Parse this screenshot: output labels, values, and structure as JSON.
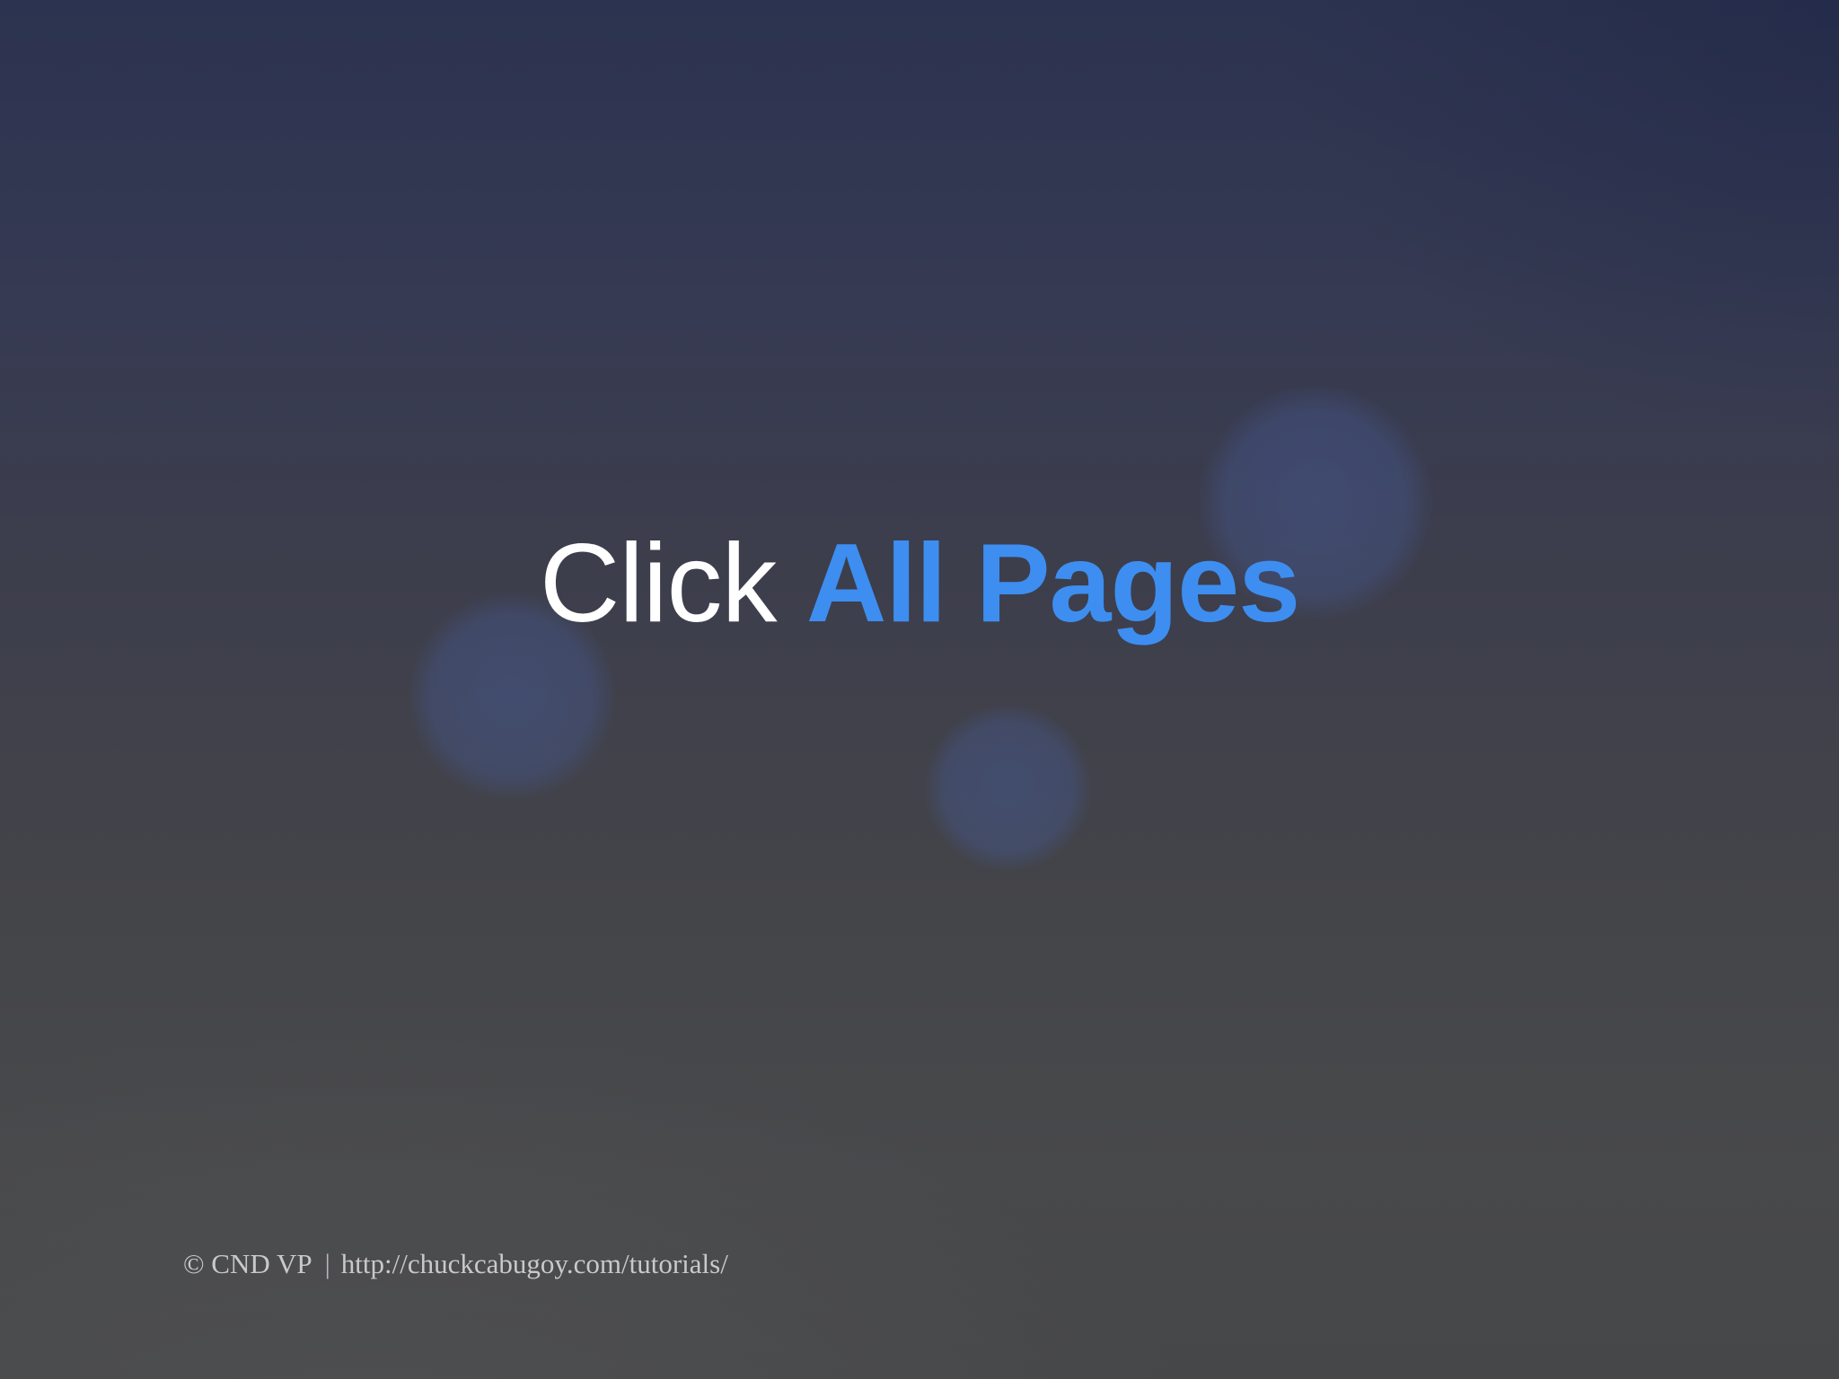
{
  "slide": {
    "headline": {
      "plain": "Click",
      "accent": "All Pages"
    },
    "footer": {
      "copyright": "© CND VP",
      "separator": "|",
      "url": "http://chuckcabugoy.com/tutorials/"
    }
  },
  "colors": {
    "accent": "#3d8ef0",
    "text": "#ffffff",
    "footer_text": "#c9c9cc"
  }
}
